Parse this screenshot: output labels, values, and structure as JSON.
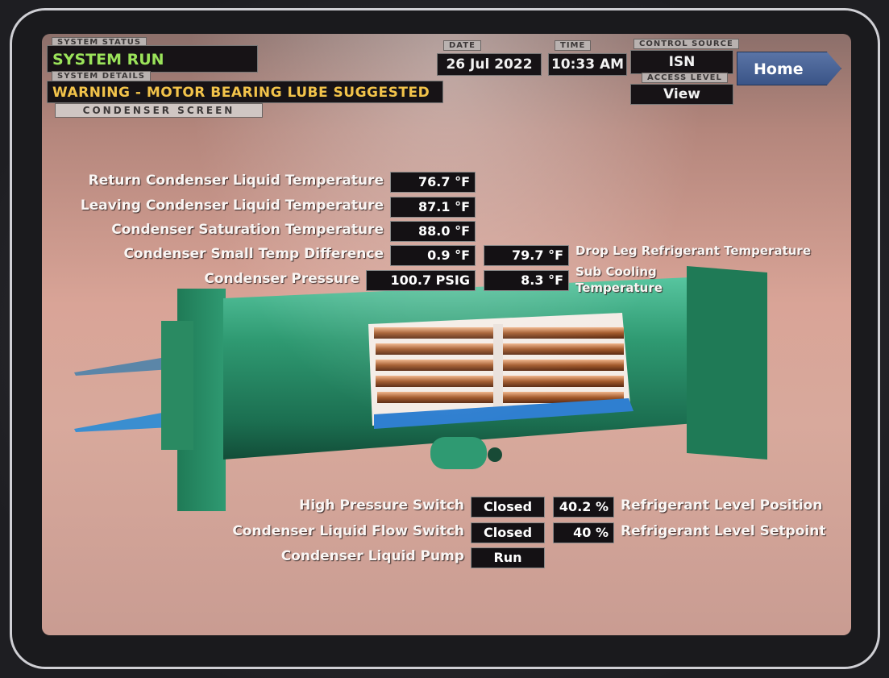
{
  "header": {
    "system_status_label": "SYSTEM STATUS",
    "system_status": "SYSTEM RUN",
    "system_details_label": "SYSTEM DETAILS",
    "system_details": "WARNING - MOTOR BEARING LUBE SUGGESTED",
    "screen_name": "CONDENSER SCREEN",
    "date_label": "DATE",
    "date": "26 Jul 2022",
    "time_label": "TIME",
    "time": "10:33 AM",
    "control_source_label": "CONTROL SOURCE",
    "control_source": "ISN",
    "access_level_label": "ACCESS LEVEL",
    "access_level": "View",
    "home_button": "Home"
  },
  "readings": {
    "return_temp_label": "Return Condenser Liquid Temperature",
    "return_temp": "76.7 °F",
    "leaving_temp_label": "Leaving Condenser Liquid Temperature",
    "leaving_temp": "87.1 °F",
    "saturation_temp_label": "Condenser Saturation Temperature",
    "saturation_temp": "88.0 °F",
    "small_temp_diff_label": "Condenser Small Temp Difference",
    "small_temp_diff": "0.9 °F",
    "drop_leg_temp": "79.7 °F",
    "drop_leg_label": "Drop Leg Refrigerant Temperature",
    "pressure_label": "Condenser Pressure",
    "pressure": "100.7 PSIG",
    "sub_cooling": "8.3 °F",
    "sub_cooling_label_1": "Sub Cooling",
    "sub_cooling_label_2": "Temperature"
  },
  "switches": {
    "high_pressure_label": "High Pressure Switch",
    "high_pressure": "Closed",
    "flow_switch_label": "Condenser Liquid Flow Switch",
    "flow_switch": "Closed",
    "pump_label": "Condenser Liquid Pump",
    "pump": "Run",
    "level_position": "40.2 %",
    "level_position_label": "Refrigerant Level Position",
    "level_setpoint": "40 %",
    "level_setpoint_label": "Refrigerant Level Setpoint"
  },
  "colors": {
    "status_green": "#9be35a",
    "warning_amber": "#f2c34a",
    "vessel_green": "#2f9a72",
    "home_blue": "#4a64a0"
  }
}
